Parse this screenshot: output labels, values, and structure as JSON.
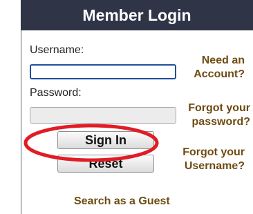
{
  "header": {
    "title": "Member Login"
  },
  "form": {
    "username_label": "Username:",
    "username_value": "",
    "password_label": "Password:",
    "password_value": "",
    "signin_label": "Sign In",
    "reset_label": "Reset"
  },
  "links": {
    "need_account_1": "Need an",
    "need_account_2": "Account?",
    "forgot_password_1": "Forgot your",
    "forgot_password_2": "password?",
    "forgot_username_1": "Forgot your",
    "forgot_username_2": "Username?",
    "guest": "Search as a Guest"
  },
  "colors": {
    "header_bg": "#2f3547",
    "link": "#6e4b12",
    "annotation": "#e01c24"
  }
}
